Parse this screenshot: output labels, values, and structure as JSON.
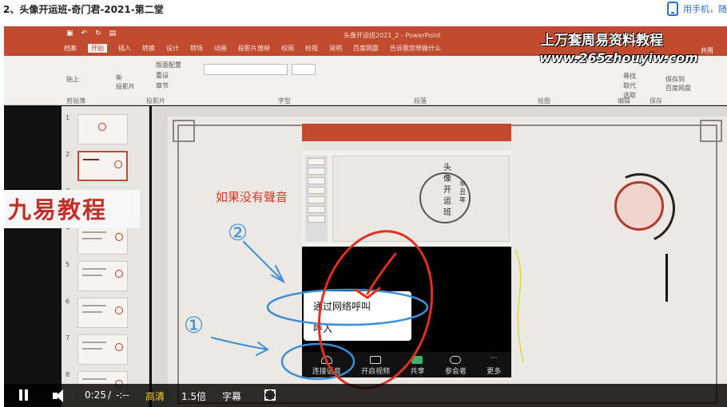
{
  "page": {
    "title": "2、头像开运班-奇门君-2021-第二堂",
    "phone_link": "用手机，随"
  },
  "ppt": {
    "window_title": "头像开运班2021_2 - PowerPoint",
    "tabs": [
      "档案",
      "开始",
      "插入",
      "转换",
      "设计",
      "转场",
      "动画",
      "投影片放映",
      "校阅",
      "检视",
      "说明",
      "百度网盘",
      "告诉我您想做什么"
    ],
    "active_tab": "开始",
    "group_labels": [
      "剪贴簿",
      "投影片",
      "字型",
      "段落",
      "绘图",
      "编辑",
      "保存"
    ],
    "buttons": {
      "paste": "贴上",
      "new_slide": "新\n投影片",
      "layout": "版面配置",
      "reset": "重设",
      "section": "章节",
      "find": "尋找",
      "replace": "取代",
      "select": "选取",
      "save_baidu": "保存到\n百度网盘",
      "share": "共用"
    },
    "slide_numbers": [
      "1",
      "2",
      "3",
      "4",
      "5",
      "6",
      "7",
      "8"
    ]
  },
  "slide": {
    "no_sound_text": "如果没有聲音",
    "embed": {
      "title_chars": [
        "头",
        "像",
        "开",
        "运",
        "班"
      ],
      "side_chars": [
        "辛",
        "丑",
        "年"
      ]
    },
    "menu": {
      "item1": "通过网络呼叫",
      "item2": "呼入"
    },
    "bottom_bar": [
      "连接语音",
      "开启视频",
      "共享",
      "参会者",
      "更多"
    ]
  },
  "watermarks": {
    "left": "九易教程",
    "top": "上万套周易资料教程",
    "url": "www.265zhouyiw.com"
  },
  "annotations": {
    "circle_1": "①",
    "circle_2": "②"
  },
  "controls": {
    "time_current": "0:25",
    "time_sep": "/",
    "time_total": "-:--",
    "quality": "高清",
    "speed": "1.5倍",
    "subtitle": "字幕"
  },
  "colors": {
    "ppt_accent": "#c14b2e",
    "annotation_blue": "#3a8fd9",
    "annotation_red": "#e0301e",
    "quality_highlight": "#ffcc33",
    "link_blue": "#2a6fc9"
  }
}
